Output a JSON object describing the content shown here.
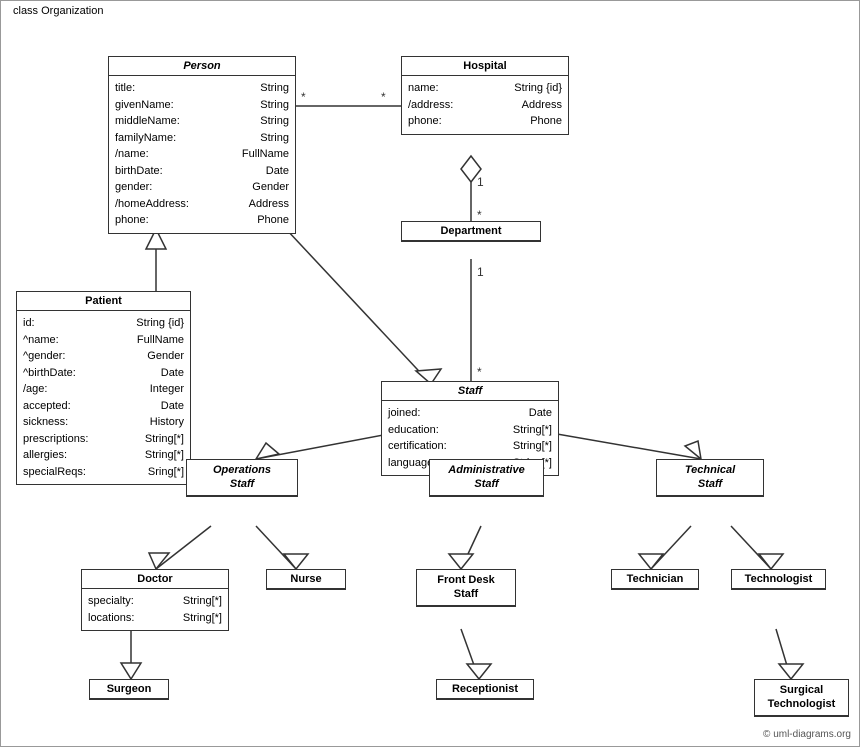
{
  "diagram": {
    "title": "class Organization",
    "classes": {
      "person": {
        "name": "Person",
        "italic": true,
        "attrs": [
          {
            "name": "title:",
            "type": "String"
          },
          {
            "name": "givenName:",
            "type": "String"
          },
          {
            "name": "middleName:",
            "type": "String"
          },
          {
            "name": "familyName:",
            "type": "String"
          },
          {
            "name": "/name:",
            "type": "FullName"
          },
          {
            "name": "birthDate:",
            "type": "Date"
          },
          {
            "name": "gender:",
            "type": "Gender"
          },
          {
            "name": "/homeAddress:",
            "type": "Address"
          },
          {
            "name": "phone:",
            "type": "Phone"
          }
        ]
      },
      "hospital": {
        "name": "Hospital",
        "italic": false,
        "attrs": [
          {
            "name": "name:",
            "type": "String {id}"
          },
          {
            "name": "/address:",
            "type": "Address"
          },
          {
            "name": "phone:",
            "type": "Phone"
          }
        ]
      },
      "patient": {
        "name": "Patient",
        "italic": false,
        "attrs": [
          {
            "name": "id:",
            "type": "String {id}"
          },
          {
            "name": "^name:",
            "type": "FullName"
          },
          {
            "name": "^gender:",
            "type": "Gender"
          },
          {
            "name": "^birthDate:",
            "type": "Date"
          },
          {
            "name": "/age:",
            "type": "Integer"
          },
          {
            "name": "accepted:",
            "type": "Date"
          },
          {
            "name": "sickness:",
            "type": "History"
          },
          {
            "name": "prescriptions:",
            "type": "String[*]"
          },
          {
            "name": "allergies:",
            "type": "String[*]"
          },
          {
            "name": "specialReqs:",
            "type": "Sring[*]"
          }
        ]
      },
      "department": {
        "name": "Department",
        "italic": false,
        "attrs": []
      },
      "staff": {
        "name": "Staff",
        "italic": true,
        "attrs": [
          {
            "name": "joined:",
            "type": "Date"
          },
          {
            "name": "education:",
            "type": "String[*]"
          },
          {
            "name": "certification:",
            "type": "String[*]"
          },
          {
            "name": "languages:",
            "type": "String[*]"
          }
        ]
      },
      "operations_staff": {
        "name": "Operations\nStaff",
        "italic": true,
        "attrs": []
      },
      "administrative_staff": {
        "name": "Administrative\nStaff",
        "italic": true,
        "attrs": []
      },
      "technical_staff": {
        "name": "Technical\nStaff",
        "italic": true,
        "attrs": []
      },
      "doctor": {
        "name": "Doctor",
        "italic": false,
        "attrs": [
          {
            "name": "specialty:",
            "type": "String[*]"
          },
          {
            "name": "locations:",
            "type": "String[*]"
          }
        ]
      },
      "nurse": {
        "name": "Nurse",
        "italic": false,
        "attrs": []
      },
      "front_desk_staff": {
        "name": "Front Desk\nStaff",
        "italic": false,
        "attrs": []
      },
      "technician": {
        "name": "Technician",
        "italic": false,
        "attrs": []
      },
      "technologist": {
        "name": "Technologist",
        "italic": false,
        "attrs": []
      },
      "surgeon": {
        "name": "Surgeon",
        "italic": false,
        "attrs": []
      },
      "receptionist": {
        "name": "Receptionist",
        "italic": false,
        "attrs": []
      },
      "surgical_technologist": {
        "name": "Surgical\nTechnologist",
        "italic": false,
        "attrs": []
      }
    },
    "copyright": "© uml-diagrams.org"
  }
}
